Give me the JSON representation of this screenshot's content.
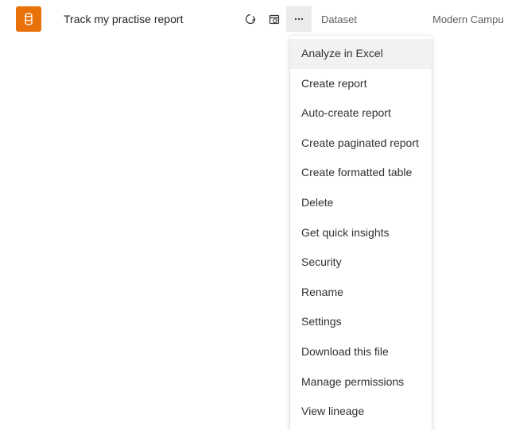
{
  "row": {
    "title": "Track my practise report",
    "type_label": "Dataset",
    "workspace_label": "Modern Campu"
  },
  "menu": {
    "items": [
      "Analyze in Excel",
      "Create report",
      "Auto-create report",
      "Create paginated report",
      "Create formatted table",
      "Delete",
      "Get quick insights",
      "Security",
      "Rename",
      "Settings",
      "Download this file",
      "Manage permissions",
      "View lineage"
    ],
    "hover_index": 0
  }
}
